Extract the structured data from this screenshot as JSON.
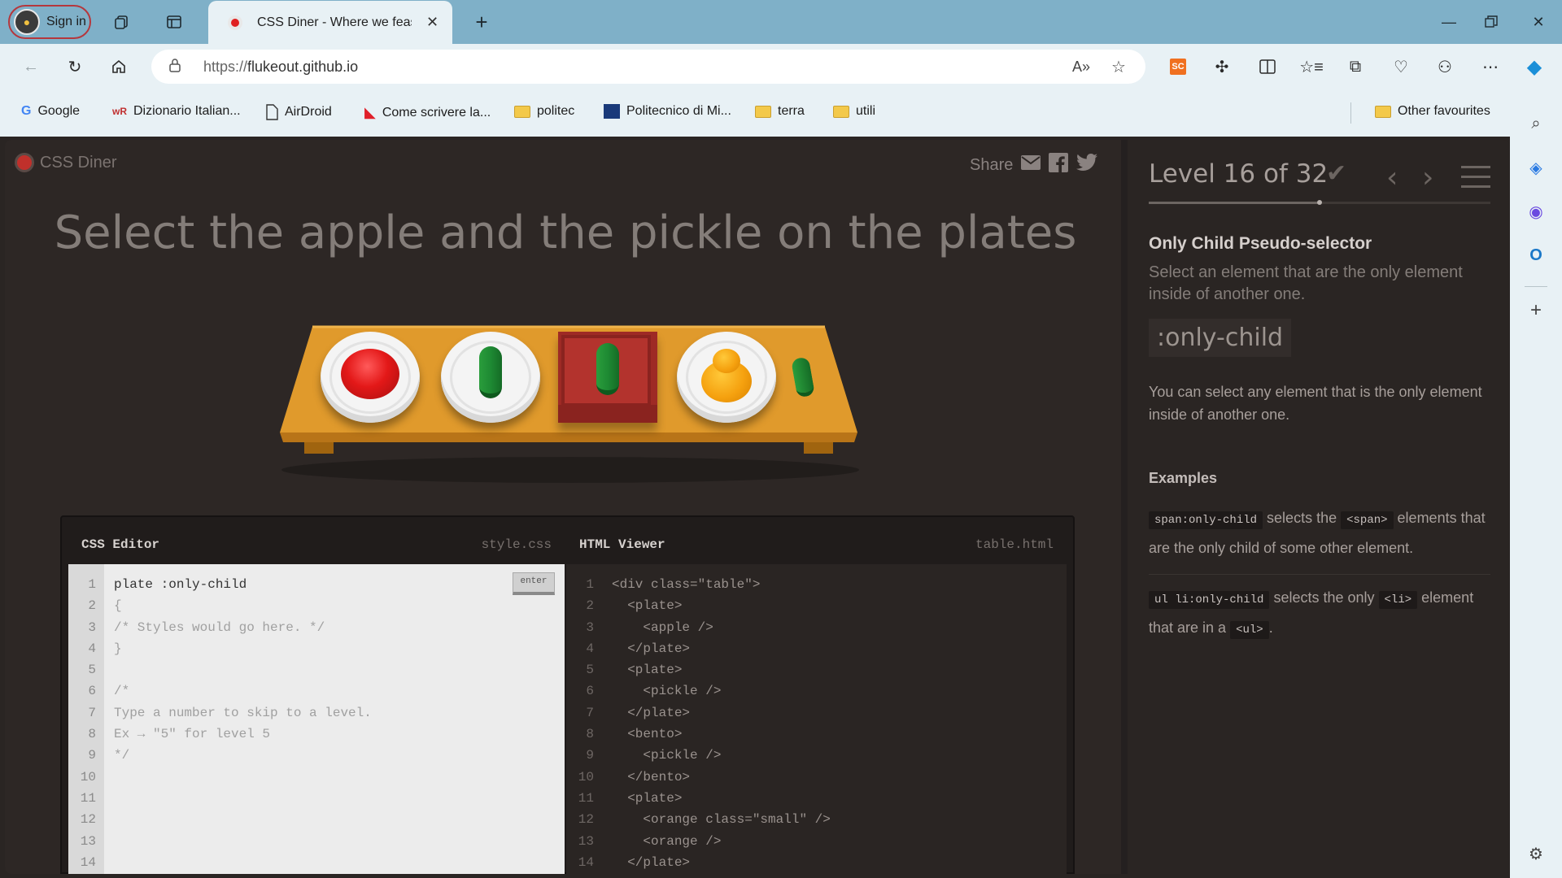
{
  "browser": {
    "signin_label": "Sign in",
    "tab_title": "CSS Diner - Where we feast",
    "url_proto": "https://",
    "url_host": "flukeout.github.io",
    "bookmarks": [
      {
        "label": "Google",
        "icon": "google-icon"
      },
      {
        "label": "Dizionario Italian...",
        "icon": "wordreference-icon"
      },
      {
        "label": "AirDroid",
        "icon": "page-icon"
      },
      {
        "label": "Come scrivere la...",
        "icon": "flag-icon"
      },
      {
        "label": "politec",
        "icon": "folder-icon"
      },
      {
        "label": "Politecnico di Mi...",
        "icon": "polimi-icon"
      },
      {
        "label": "terra",
        "icon": "folder-icon"
      },
      {
        "label": "utili",
        "icon": "folder-icon"
      }
    ],
    "other_favourites": "Other favourites",
    "extension_badge": "SC"
  },
  "game": {
    "logo": "CSS Diner",
    "share_label": "Share",
    "instruction": "Select the apple and the pickle on the plates"
  },
  "editor": {
    "css_title": "CSS Editor",
    "css_file": "style.css",
    "html_title": "HTML Viewer",
    "html_file": "table.html",
    "enter_label": "enter",
    "css_lines": [
      "plate :only-child",
      "{",
      "/* Styles would go here. */",
      "}",
      "",
      "/*",
      "Type a number to skip to a level.",
      "Ex → \"5\" for level 5",
      "*/",
      "",
      "",
      "",
      "",
      ""
    ],
    "html_lines": [
      "<div class=\"table\">",
      "  <plate>",
      "    <apple />",
      "  </plate>",
      "  <plate>",
      "    <pickle />",
      "  </plate>",
      "  <bento>",
      "    <pickle />",
      "  </bento>",
      "  <plate>",
      "    <orange class=\"small\" />",
      "    <orange />",
      "  </plate>"
    ],
    "line_numbers": [
      "1",
      "2",
      "3",
      "4",
      "5",
      "6",
      "7",
      "8",
      "9",
      "10",
      "11",
      "12",
      "13",
      "14"
    ]
  },
  "level": {
    "label": "Level 16 of 32",
    "current": 16,
    "total": 32,
    "selector_name": "Only Child Pseudo-selector",
    "selector_title": "Select an element that are the only element inside of another one.",
    "syntax": ":only-child",
    "hint": "You can select any element that is the only element inside of another one.",
    "examples_title": "Examples",
    "example1": {
      "code": "span:only-child",
      "text1": "selects the",
      "code2": "<span>",
      "text2": "elements that are the only child of some other element."
    },
    "example2": {
      "code": "ul li:only-child",
      "text1": "selects the only",
      "code2": "<li>",
      "text2": "element that are in a",
      "code3": "<ul>",
      "text3": "."
    }
  },
  "colors": {
    "accent_red": "#c0302b",
    "table": "#e09a2c",
    "bento": "#9e2a25"
  }
}
